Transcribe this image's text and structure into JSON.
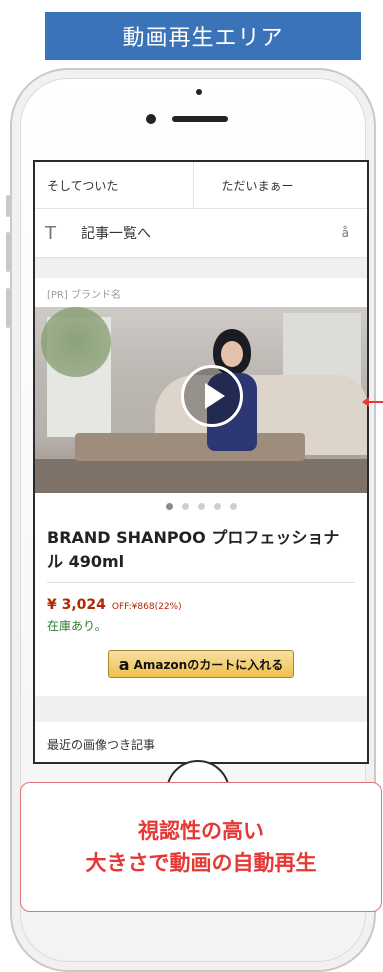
{
  "banner": {
    "title": "動画再生エリア"
  },
  "article_nav": {
    "prev": "そしてついた",
    "next": "ただいまぁー"
  },
  "list_link": {
    "label": "記事一覧へ",
    "left_icon": "T",
    "right_icon": "å"
  },
  "ad": {
    "pr_label": "[PR] ブランド名",
    "product_name": "BRAND SHANPOO プロフェッショナル 490ml",
    "price": "¥ 3,024",
    "off": "OFF:¥868(22%)",
    "stock": "在庫あり。",
    "cart_logo": "a",
    "cart_label": "Amazonのカートに入れる",
    "carousel_total": 5,
    "carousel_active": 1
  },
  "recent": {
    "label": "最近の画像つき記事"
  },
  "callout": {
    "line1": "視認性の高い",
    "line2": "大きさで動画の自動再生"
  },
  "colors": {
    "banner": "#3b73b9",
    "accent_red": "#e53935",
    "price": "#b12704",
    "stock": "#2e7d32",
    "amazon_button": "#f0c14b"
  }
}
